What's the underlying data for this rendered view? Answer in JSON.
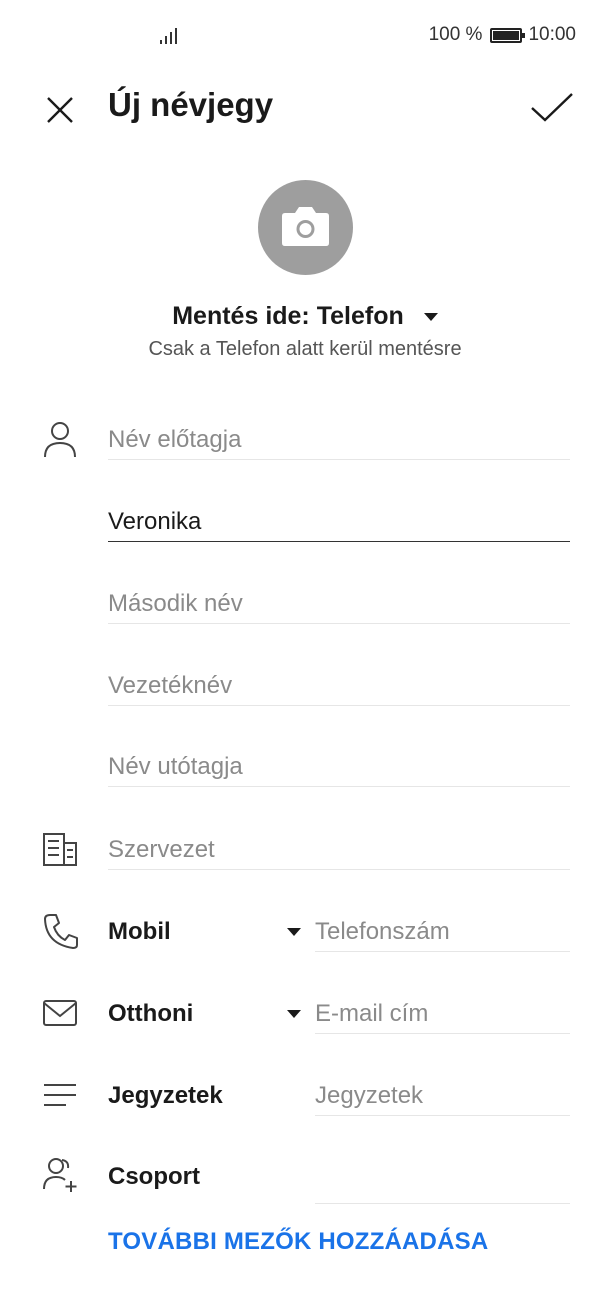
{
  "status_bar": {
    "battery_percent": "100 %",
    "time": "10:00"
  },
  "header": {
    "title": "Új névjegy"
  },
  "save_location": {
    "label": "Mentés ide: Telefon",
    "note": "Csak a Telefon alatt kerül mentésre"
  },
  "name_fields": {
    "prefix_placeholder": "Név előtagja",
    "first_name_value": "Veronika",
    "middle_placeholder": "Második név",
    "last_placeholder": "Vezetéknév",
    "suffix_placeholder": "Név utótagja"
  },
  "organization": {
    "placeholder": "Szervezet"
  },
  "phone": {
    "type_label": "Mobil",
    "placeholder": "Telefonszám"
  },
  "email": {
    "type_label": "Otthoni",
    "placeholder": "E-mail cím"
  },
  "notes": {
    "label": "Jegyzetek",
    "placeholder": "Jegyzetek"
  },
  "group": {
    "label": "Csoport"
  },
  "add_more": {
    "label": "TOVÁBBI MEZŐK HOZZÁADÁSA"
  },
  "colors": {
    "accent": "#1a73e8",
    "photo_bg": "#9e9e9e"
  }
}
